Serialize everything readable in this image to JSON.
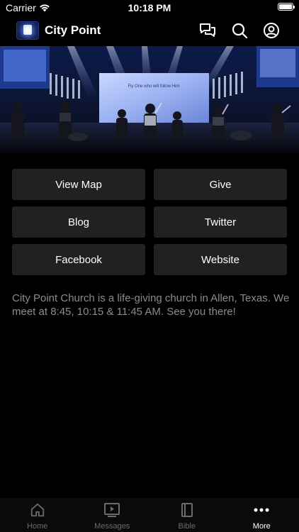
{
  "status": {
    "carrier": "Carrier",
    "time": "10:18 PM"
  },
  "header": {
    "title": "City Point"
  },
  "hero": {
    "screen_text": "Fly One who will follow Him"
  },
  "buttons": {
    "view_map": "View Map",
    "give": "Give",
    "blog": "Blog",
    "twitter": "Twitter",
    "facebook": "Facebook",
    "website": "Website"
  },
  "description": "City Point Church is a life-giving church in Allen, Texas. We meet at 8:45, 10:15 & 11:45 AM. See you there!",
  "tabs": [
    {
      "label": "Home",
      "icon": "home-icon"
    },
    {
      "label": "Messages",
      "icon": "play-icon"
    },
    {
      "label": "Bible",
      "icon": "book-icon"
    },
    {
      "label": "More",
      "icon": "more-icon"
    }
  ],
  "colors": {
    "background": "#000000",
    "button": "#212121",
    "description_text": "#8b8b8b",
    "tab_inactive": "#6b6b6b",
    "tab_active": "#ffffff"
  }
}
